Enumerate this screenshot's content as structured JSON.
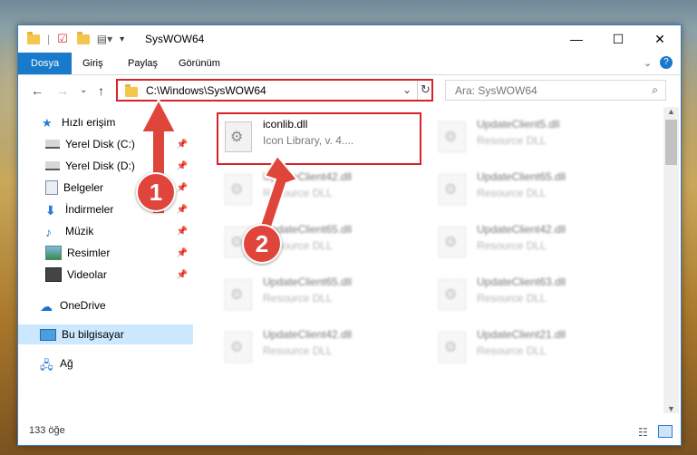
{
  "window": {
    "title": "SysWOW64",
    "controls": {
      "minimize": "—",
      "maximize": "☐",
      "close": "✕"
    }
  },
  "ribbon": {
    "tabs": [
      "Dosya",
      "Giriş",
      "Paylaş",
      "Görünüm"
    ]
  },
  "address": {
    "path": "C:\\Windows\\SysWOW64",
    "search_placeholder": "Ara: SysWOW64"
  },
  "sidebar": {
    "items": [
      {
        "label": "Hızlı erişim",
        "icon": "star-icon",
        "pinned": false
      },
      {
        "label": "Yerel Disk (C:)",
        "icon": "drive-icon",
        "pinned": true
      },
      {
        "label": "Yerel Disk (D:)",
        "icon": "drive-icon",
        "pinned": true
      },
      {
        "label": "Belgeler",
        "icon": "documents-icon",
        "pinned": true
      },
      {
        "label": "İndirmeler",
        "icon": "download-icon",
        "pinned": true
      },
      {
        "label": "Müzik",
        "icon": "music-icon",
        "pinned": true
      },
      {
        "label": "Resimler",
        "icon": "pictures-icon",
        "pinned": true
      },
      {
        "label": "Videolar",
        "icon": "video-icon",
        "pinned": true
      },
      {
        "label": "OneDrive",
        "icon": "cloud-icon",
        "pinned": false
      },
      {
        "label": "Bu bilgisayar",
        "icon": "computer-icon",
        "pinned": false,
        "selected": true
      },
      {
        "label": "Ağ",
        "icon": "network-icon",
        "pinned": false
      }
    ]
  },
  "files": [
    {
      "name": "iconlib.dll",
      "desc": "Icon Library, v. 4....",
      "blurred": false
    },
    {
      "name": "UpdateClient5.dll",
      "desc": "Resource DLL",
      "blurred": true
    },
    {
      "name": "UpdateClient42.dll",
      "desc": "Resource DLL",
      "blurred": true
    },
    {
      "name": "UpdateClient65.dll",
      "desc": "Resource DLL",
      "blurred": true
    },
    {
      "name": "UpdateClient65.dll",
      "desc": "Resource DLL",
      "blurred": true
    },
    {
      "name": "UpdateClient42.dll",
      "desc": "Resource DLL",
      "blurred": true
    },
    {
      "name": "UpdateClient65.dll",
      "desc": "Resource DLL",
      "blurred": true
    },
    {
      "name": "UpdateClient63.dll",
      "desc": "Resource DLL",
      "blurred": true
    },
    {
      "name": "UpdateClient42.dll",
      "desc": "Resource DLL",
      "blurred": true
    },
    {
      "name": "UpdateClient21.dll",
      "desc": "Resource DLL",
      "blurred": true
    }
  ],
  "status": {
    "count": "133 öğe"
  },
  "annotations": {
    "step1": "1",
    "step2": "2"
  },
  "colors": {
    "accent": "#1979ca",
    "highlight": "#d8222a",
    "badge": "#e0453b"
  }
}
